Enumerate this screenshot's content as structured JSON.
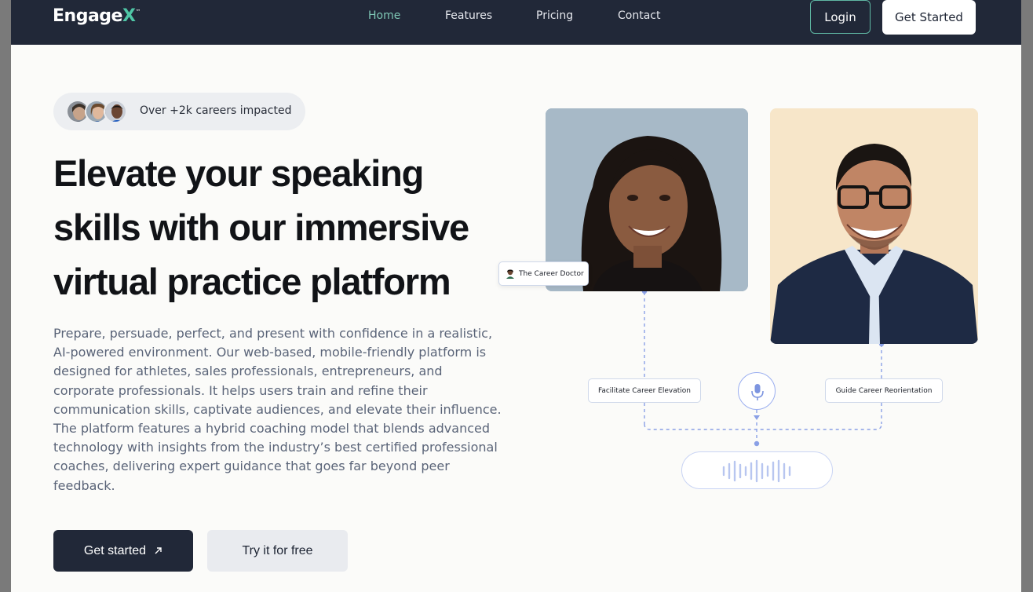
{
  "nav": {
    "logo_main": "Engage",
    "logo_accent": "X",
    "logo_tm": "™",
    "links": [
      "Home",
      "Features",
      "Pricing",
      "Contact"
    ],
    "active_link": "Home",
    "login_label": "Login",
    "get_started_label": "Get Started"
  },
  "hero": {
    "badge_text": "Over +2k careers impacted",
    "headline_lines": [
      "Elevate your speaking",
      "skills with our immersive",
      "virtual practice platform"
    ],
    "description": "Prepare, persuade, perfect, and present with confidence in a realistic, AI-powered environment. Our web-based, mobile-friendly platform is designed for athletes, sales professionals, entrepreneurs, and corporate professionals. It helps users train and refine their communication skills, captivate audiences, and elevate their influence. The platform features a hybrid coaching model that blends advanced technology with insights from the industry’s best certified professional coaches, delivering expert guidance that goes far beyond peer feedback.",
    "cta_primary": "Get started",
    "cta_primary_icon": "arrow-up-right-icon",
    "cta_secondary": "Try it for free"
  },
  "illustration": {
    "coach_tag": "The Career Doctor",
    "left_action": "Facilitate Career Elevation",
    "right_action": "Guide Career Reorientation",
    "mic_icon": "microphone-icon",
    "wave_icon": "sound-wave-icon"
  },
  "colors": {
    "nav_bg": "#212838",
    "accent_teal": "#4fc6a6",
    "connector_blue": "#8aa0e6"
  }
}
